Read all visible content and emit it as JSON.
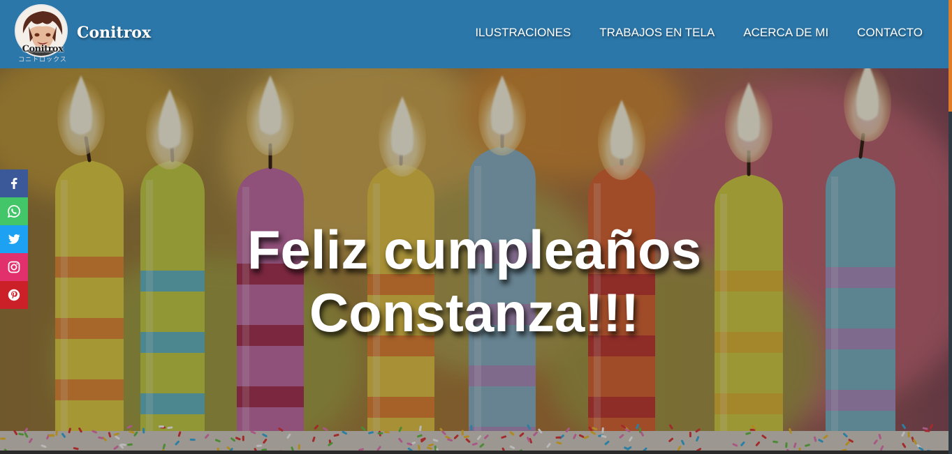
{
  "header": {
    "logo": {
      "text": "Conitrox",
      "subtext": "コニトロックス"
    },
    "site_name": "Conitrox",
    "nav": [
      {
        "label": "ILUSTRACIONES"
      },
      {
        "label": "TRABAJOS EN TELA"
      },
      {
        "label": "ACERCA DE MI"
      },
      {
        "label": "CONTACTO"
      }
    ],
    "background_color": "#2b77aa"
  },
  "hero": {
    "title_line1": "Feliz cumpleaños",
    "title_line2": "Constanza!!!",
    "image_subject": "birthday-candles"
  },
  "social": [
    {
      "icon": "facebook-icon",
      "color": "#3b5998"
    },
    {
      "icon": "whatsapp-icon",
      "color": "#43c569"
    },
    {
      "icon": "twitter-icon",
      "color": "#1da1f2"
    },
    {
      "icon": "instagram-icon",
      "color": "#e1306c"
    },
    {
      "icon": "pinterest-icon",
      "color": "#cb2027"
    }
  ],
  "accent_color": "#e07b27"
}
